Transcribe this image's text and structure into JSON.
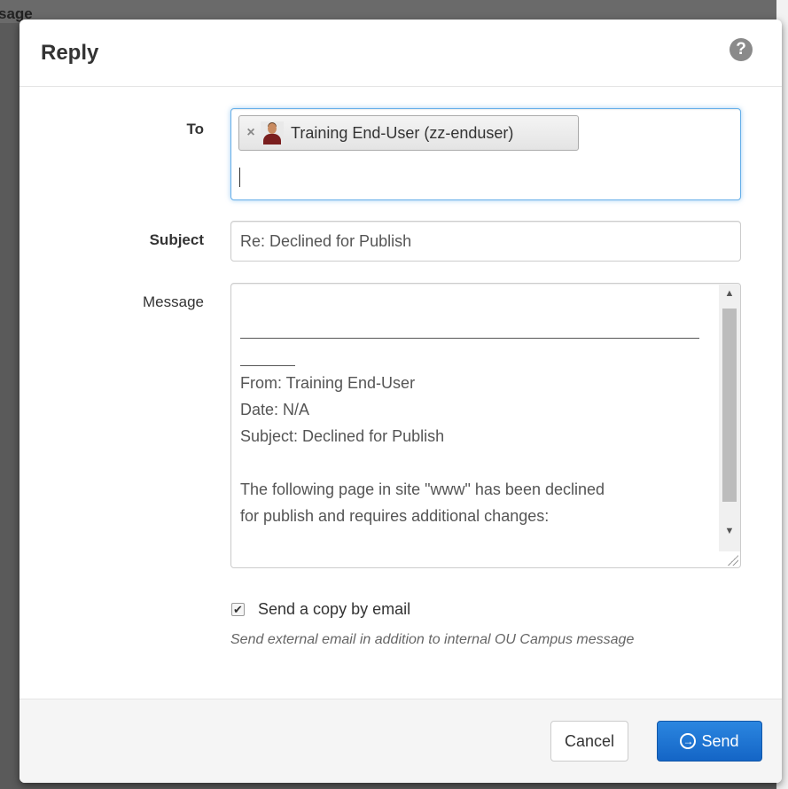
{
  "backdrop": {
    "partial_title": "sage"
  },
  "dialog": {
    "title": "Reply",
    "help_icon": "question-circle-icon"
  },
  "form": {
    "to": {
      "label": "To",
      "recipients": [
        {
          "name": "Training End-User (zz-enduser)",
          "remove_glyph": "×",
          "avatar_icon": "user-avatar"
        }
      ],
      "input_value": ""
    },
    "subject": {
      "label": "Subject",
      "value": "Re: Declined for Publish"
    },
    "message": {
      "label": "Message",
      "lines": [
        "From: Training End-User",
        "Date: N/A",
        "Subject: Declined for Publish",
        "",
        "The following page in site \"www\" has been declined",
        "for publish and requires additional changes:"
      ]
    },
    "send_copy": {
      "checked": true,
      "label": "Send a copy by email",
      "help": "Send external email in addition to internal OU Campus message"
    }
  },
  "footer": {
    "cancel_label": "Cancel",
    "send_label": "Send",
    "send_icon": "arrow-circle-right-icon"
  },
  "colors": {
    "primary": "#1a6fd0",
    "focus_border": "#66afe9",
    "footer_bg": "#f5f5f5"
  }
}
